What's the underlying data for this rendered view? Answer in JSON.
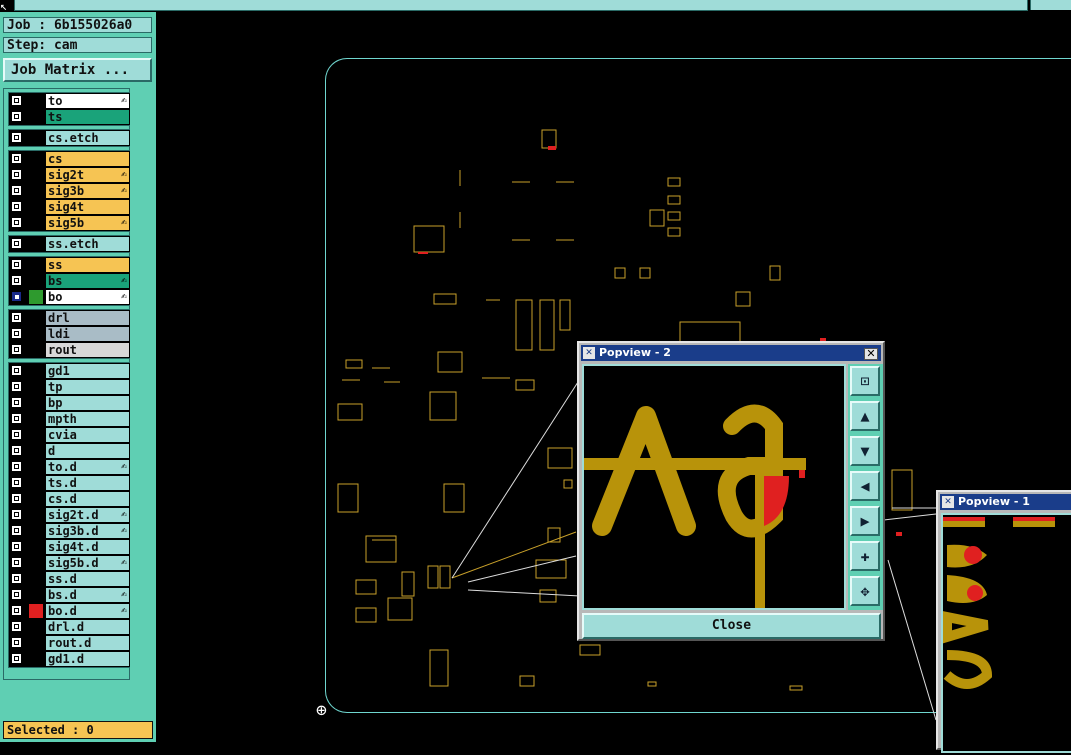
{
  "header": {
    "job_label": "Job : 6b155026a0",
    "step_label": "Step: cam",
    "job_matrix_button": "Job Matrix ..."
  },
  "layers": [
    {
      "name": "to",
      "color": "#ffffff",
      "checked": false,
      "swatch": "#000000",
      "editable": true
    },
    {
      "name": "ts",
      "color": "#1aa37a",
      "checked": false,
      "swatch": "#000000",
      "editable": false
    },
    {
      "name": "cs.etch",
      "color": "#9fdcd8",
      "checked": false,
      "swatch": "#000000",
      "editable": false
    },
    {
      "name": "cs",
      "color": "#f6c453",
      "checked": false,
      "swatch": "#000000",
      "editable": false
    },
    {
      "name": "sig2t",
      "color": "#f6c453",
      "checked": false,
      "swatch": "#000000",
      "editable": true
    },
    {
      "name": "sig3b",
      "color": "#f6c453",
      "checked": false,
      "swatch": "#000000",
      "editable": true
    },
    {
      "name": "sig4t",
      "color": "#f6c453",
      "checked": false,
      "swatch": "#000000",
      "editable": false
    },
    {
      "name": "sig5b",
      "color": "#f6c453",
      "checked": false,
      "swatch": "#000000",
      "editable": true
    },
    {
      "name": "ss.etch",
      "color": "#9fdcd8",
      "checked": false,
      "swatch": "#000000",
      "editable": false
    },
    {
      "name": "ss",
      "color": "#f6c453",
      "checked": false,
      "swatch": "#000000",
      "editable": false
    },
    {
      "name": "bs",
      "color": "#1aa37a",
      "checked": false,
      "swatch": "#000000",
      "editable": true
    },
    {
      "name": "bo",
      "color": "#ffffff",
      "checked": true,
      "swatch": "#2e9a2e",
      "editable": true
    },
    {
      "name": "drl",
      "color": "#a9bcc6",
      "checked": false,
      "swatch": "#000000",
      "editable": false
    },
    {
      "name": "ldi",
      "color": "#a9bcc6",
      "checked": false,
      "swatch": "#000000",
      "editable": false
    },
    {
      "name": "rout",
      "color": "#d8d8d8",
      "checked": false,
      "swatch": "#000000",
      "editable": false
    },
    {
      "name": "gd1",
      "color": "#9fdcd8",
      "checked": false,
      "swatch": "#000000",
      "editable": false
    },
    {
      "name": "tp",
      "color": "#9fdcd8",
      "checked": false,
      "swatch": "#000000",
      "editable": false
    },
    {
      "name": "bp",
      "color": "#9fdcd8",
      "checked": false,
      "swatch": "#000000",
      "editable": false
    },
    {
      "name": "mpth",
      "color": "#9fdcd8",
      "checked": false,
      "swatch": "#000000",
      "editable": false
    },
    {
      "name": "cvia",
      "color": "#9fdcd8",
      "checked": false,
      "swatch": "#000000",
      "editable": false
    },
    {
      "name": "d",
      "color": "#9fdcd8",
      "checked": false,
      "swatch": "#000000",
      "editable": false
    },
    {
      "name": "to.d",
      "color": "#9fdcd8",
      "checked": false,
      "swatch": "#000000",
      "editable": true
    },
    {
      "name": "ts.d",
      "color": "#9fdcd8",
      "checked": false,
      "swatch": "#000000",
      "editable": false
    },
    {
      "name": "cs.d",
      "color": "#9fdcd8",
      "checked": false,
      "swatch": "#000000",
      "editable": false
    },
    {
      "name": "sig2t.d",
      "color": "#9fdcd8",
      "checked": false,
      "swatch": "#000000",
      "editable": true
    },
    {
      "name": "sig3b.d",
      "color": "#9fdcd8",
      "checked": false,
      "swatch": "#000000",
      "editable": true
    },
    {
      "name": "sig4t.d",
      "color": "#9fdcd8",
      "checked": false,
      "swatch": "#000000",
      "editable": false
    },
    {
      "name": "sig5b.d",
      "color": "#9fdcd8",
      "checked": false,
      "swatch": "#000000",
      "editable": true
    },
    {
      "name": "ss.d",
      "color": "#9fdcd8",
      "checked": false,
      "swatch": "#000000",
      "editable": false
    },
    {
      "name": "bs.d",
      "color": "#9fdcd8",
      "checked": false,
      "swatch": "#000000",
      "editable": true
    },
    {
      "name": "bo.d",
      "color": "#9fdcd8",
      "checked": false,
      "swatch": "#e02020",
      "editable": true
    },
    {
      "name": "drl.d",
      "color": "#9fdcd8",
      "checked": false,
      "swatch": "#000000",
      "editable": false
    },
    {
      "name": "rout.d",
      "color": "#9fdcd8",
      "checked": false,
      "swatch": "#000000",
      "editable": false
    },
    {
      "name": "gd1.d",
      "color": "#9fdcd8",
      "checked": false,
      "swatch": "#000000",
      "editable": false
    }
  ],
  "status": {
    "selected": "Selected : 0"
  },
  "popview2": {
    "title": "Popview - 2",
    "close_button": "Close",
    "preview_text": "Aa"
  },
  "popview1": {
    "title": "Popview - 1"
  },
  "colors": {
    "panel": "#5fcfb3",
    "cyan": "#9fdcd8",
    "yellow": "#f6c453",
    "green": "#1aa37a",
    "copper": "#b8930a",
    "red": "#e02020"
  }
}
